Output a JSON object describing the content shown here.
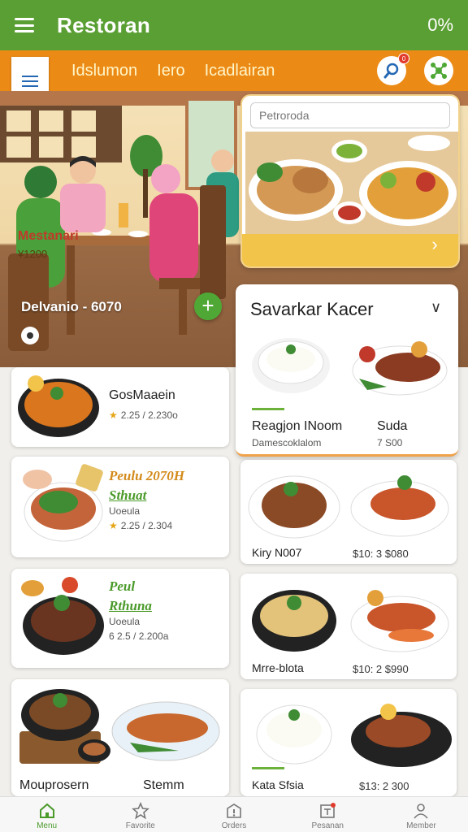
{
  "appbar": {
    "title": "Restoran",
    "status": "0%"
  },
  "subnav": {
    "links": [
      "Idslumon",
      "Iero",
      "Icadlairan"
    ],
    "notif_badge": "0"
  },
  "hero": {
    "caption": "Delvanio - 6070"
  },
  "featured": {
    "search_placeholder": "Petroroda",
    "name": "Mestanari",
    "price": "¥1200"
  },
  "panel": {
    "title": "Savarkar Kacer",
    "items": [
      {
        "name": "Reagjon INoom",
        "sub": "Damescoklalom"
      },
      {
        "name": "Suda",
        "price": "7 S00"
      }
    ]
  },
  "left_cards": [
    {
      "name": "GosMaaein",
      "rating": "2.25 / 2.230o"
    },
    {
      "italic": "Peulu 2070H",
      "green": "Sthuat",
      "sub": "Uoeula",
      "rating": "2.25 / 2.304"
    },
    {
      "italic": "Peul",
      "green": "Rthuna",
      "sub": "Uoeula",
      "rating": "6 2.5 / 2.200a"
    },
    {
      "name": "Mouprosern",
      "name2": "Stemm"
    }
  ],
  "right_cards": [
    {
      "name": "Kiry N007",
      "price": "$10: 3 $080"
    },
    {
      "name": "Mrre-blota",
      "price": "$10: 2 $990"
    },
    {
      "name": "Kata Sfsia",
      "price": "$13: 2 300"
    }
  ],
  "bottomnav": [
    {
      "label": "Menu",
      "icon": "home-icon",
      "active": true
    },
    {
      "label": "Favorite",
      "icon": "star-icon",
      "active": false
    },
    {
      "label": "Orders",
      "icon": "info-icon",
      "active": false
    },
    {
      "label": "Pesanan",
      "icon": "receipt-icon",
      "active": false
    },
    {
      "label": "Member",
      "icon": "user-icon",
      "active": false
    }
  ],
  "colors": {
    "primary": "#5a9f33",
    "accent": "#ec8a16",
    "highlight": "#f3c44a"
  }
}
